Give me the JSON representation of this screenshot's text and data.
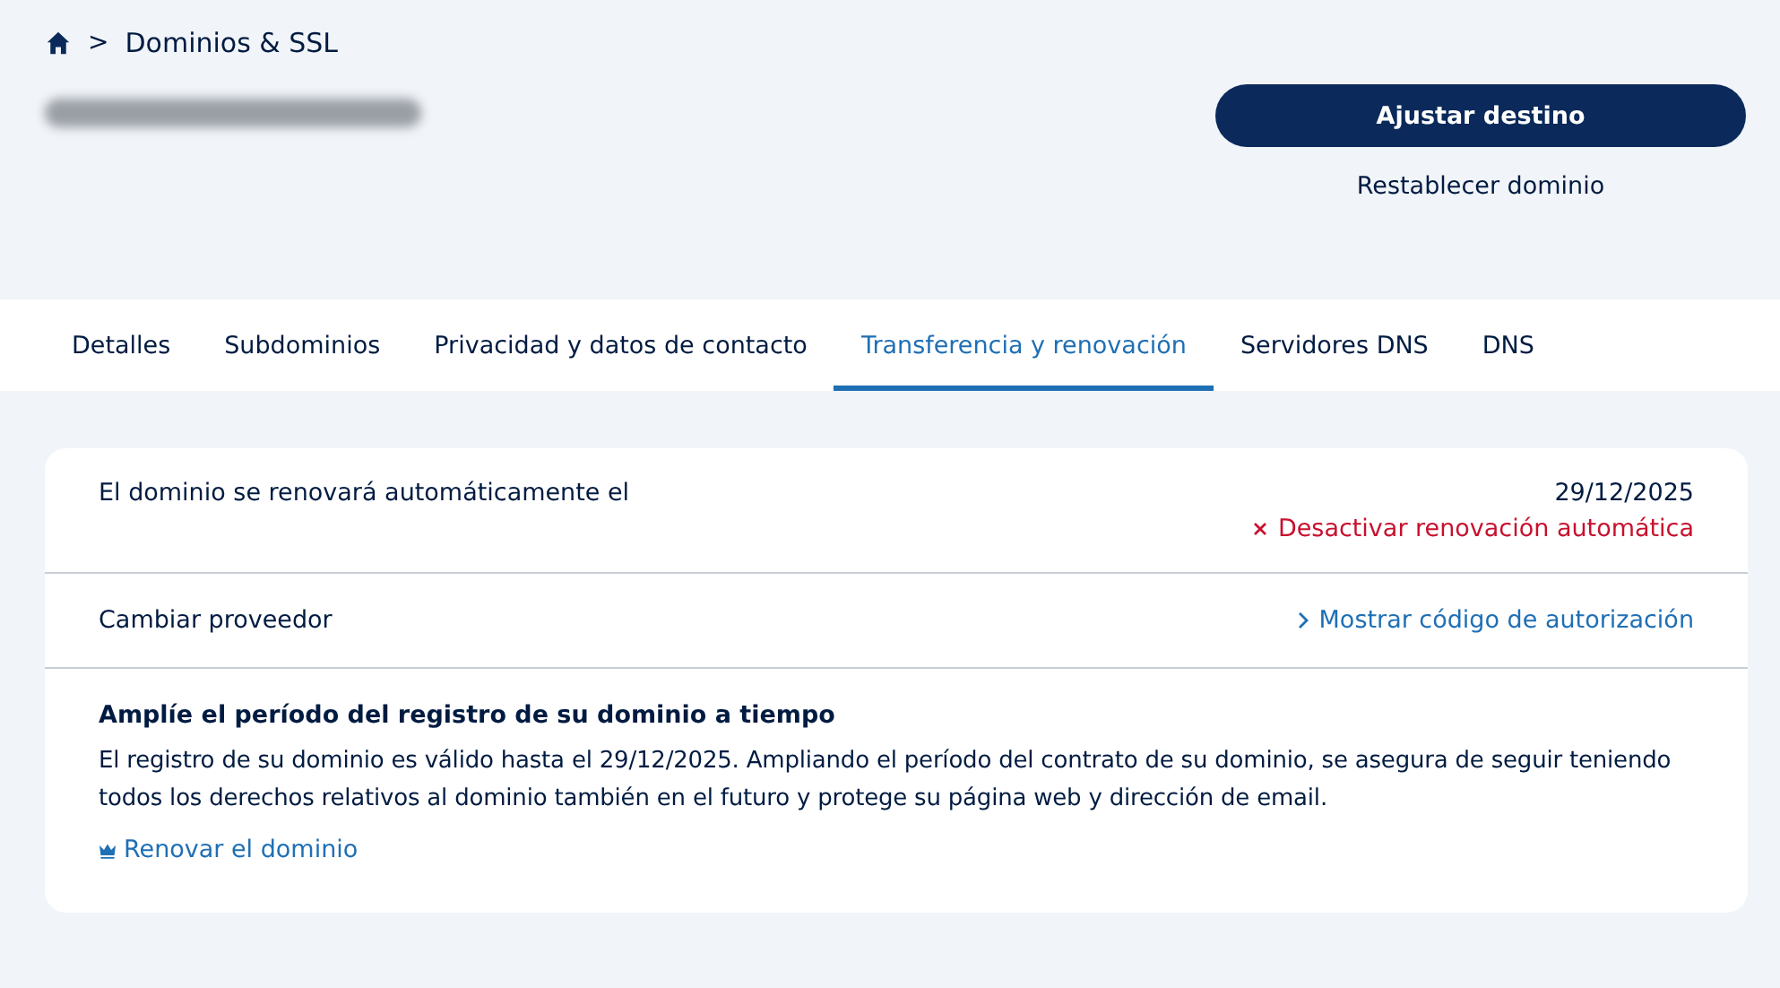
{
  "breadcrumb": {
    "separator": ">",
    "current": "Dominios & SSL"
  },
  "actions": {
    "primary": "Ajustar destino",
    "secondary": "Restablecer dominio"
  },
  "tabs": [
    {
      "label": "Detalles",
      "selected": false
    },
    {
      "label": "Subdominios",
      "selected": false
    },
    {
      "label": "Privacidad y datos de contacto",
      "selected": false
    },
    {
      "label": "Transferencia y renovación",
      "selected": true
    },
    {
      "label": "Servidores DNS",
      "selected": false
    },
    {
      "label": "DNS",
      "selected": false
    }
  ],
  "renewal": {
    "label": "El dominio se renovará automáticamente el",
    "date": "29/12/2025",
    "action": "Desactivar renovación automática"
  },
  "provider": {
    "label": "Cambiar proveedor",
    "action": "Mostrar código de autorización"
  },
  "extend": {
    "title": "Amplíe el período del registro de su dominio a tiempo",
    "text": "El registro de su dominio es válido hasta el 29/12/2025. Ampliando el período del contrato de su dominio, se asegura de seguir teniendo todos los derechos relativos al dominio también en el futuro y protege su página web y dirección de email.",
    "link": "Renovar el dominio"
  }
}
